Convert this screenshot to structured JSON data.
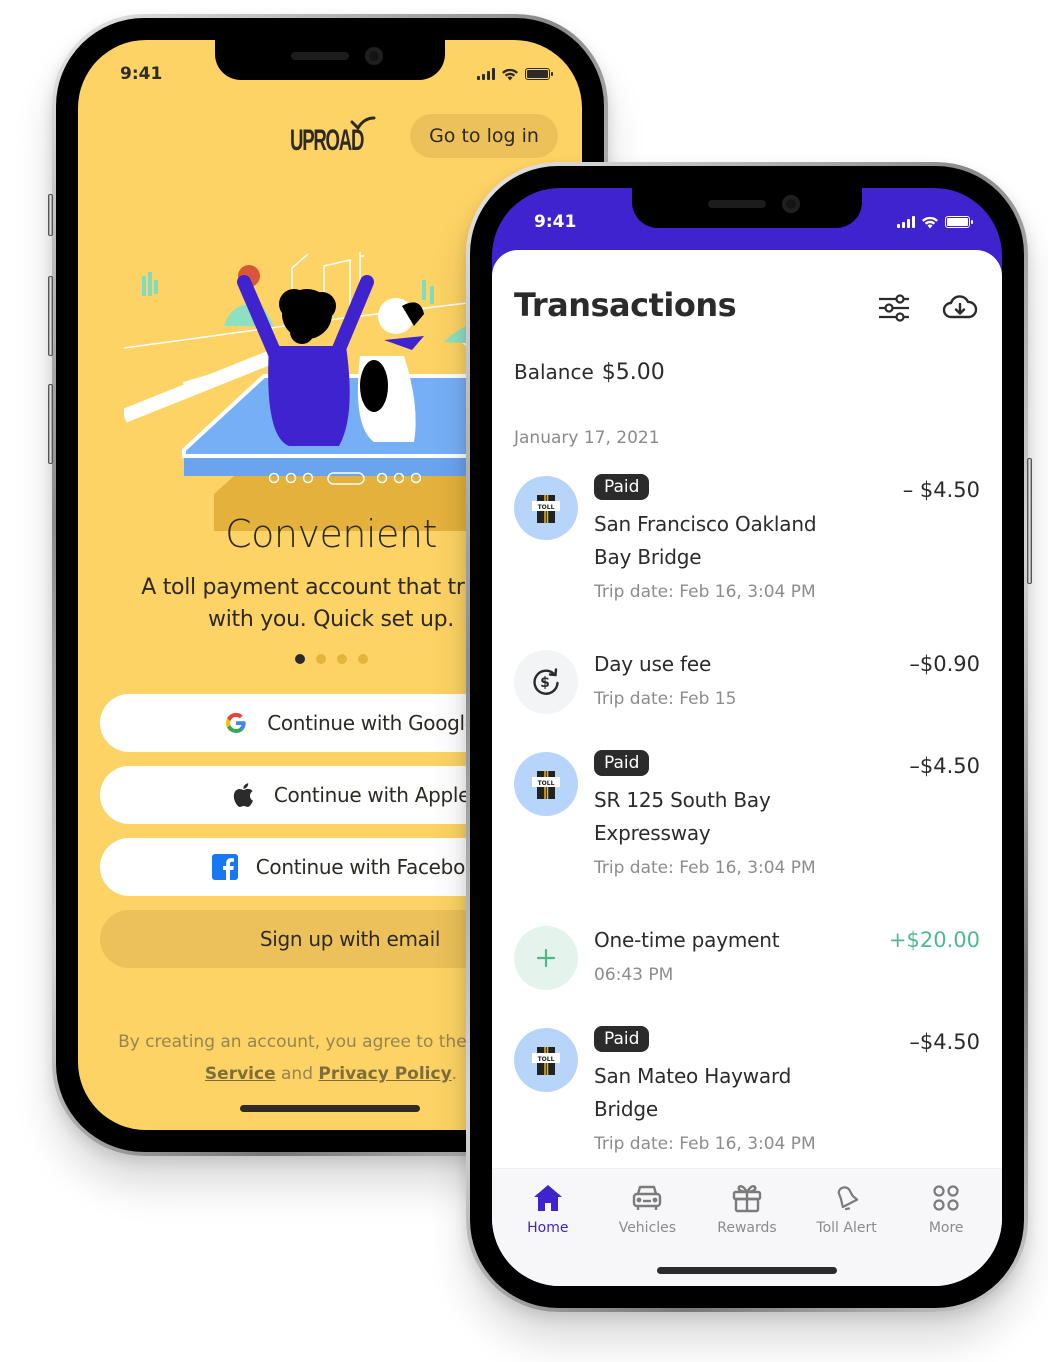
{
  "left_phone": {
    "status_time": "9:41",
    "brand": "UPROAD",
    "login_button": "Go to log in",
    "slide": {
      "title": "Convenient",
      "description": "A toll payment account that travels\nwith you. Quick set up.",
      "page_count": 4,
      "active_page": 1
    },
    "auth_buttons": [
      {
        "label": "Continue with Google",
        "icon": "google-icon"
      },
      {
        "label": "Continue with Apple",
        "icon": "apple-icon"
      },
      {
        "label": "Continue with Facebook",
        "icon": "facebook-icon"
      },
      {
        "label": "Sign up with email",
        "icon": null
      }
    ],
    "legal": {
      "prefix": "By creating an account, you agree to the Terms of",
      "terms_link": "Service",
      "and": " and ",
      "privacy_link": "Privacy Policy",
      "suffix": "."
    },
    "colors": {
      "background": "#fdd365",
      "pill": "#ecc15a"
    }
  },
  "right_phone": {
    "status_time": "9:41",
    "title": "Transactions",
    "icons": [
      "filter-sliders-icon",
      "cloud-download-icon"
    ],
    "balance_label": "Balance",
    "balance_value": "$5.00",
    "date_header": "January 17, 2021",
    "transactions": [
      {
        "type": "toll",
        "badge": "Paid",
        "name": "San Francisco Oakland\nBay Bridge",
        "sub": "Trip date: Feb 16, 3:04 PM",
        "amount": "– $4.50"
      },
      {
        "type": "fee",
        "badge": null,
        "name": "Day use fee",
        "sub": "Trip date: Feb 15",
        "amount": "–$0.90"
      },
      {
        "type": "toll",
        "badge": "Paid",
        "name": "SR 125 South Bay\nExpressway",
        "sub": "Trip date: Feb 16, 3:04 PM",
        "amount": "–$4.50"
      },
      {
        "type": "payment",
        "badge": null,
        "name": "One-time payment",
        "sub": "06:43 PM",
        "amount": "+$20.00"
      },
      {
        "type": "toll",
        "badge": "Paid",
        "name": "San Mateo Hayward\nBridge",
        "sub": "Trip date: Feb 16, 3:04 PM",
        "amount": "–$4.50"
      }
    ],
    "toll_icon_label": "TOLL",
    "tabs": [
      {
        "label": "Home",
        "icon": "home-icon",
        "active": true
      },
      {
        "label": "Vehicles",
        "icon": "car-icon",
        "active": false
      },
      {
        "label": "Rewards",
        "icon": "gift-icon",
        "active": false
      },
      {
        "label": "Toll Alert",
        "icon": "bell-icon",
        "active": false
      },
      {
        "label": "More",
        "icon": "more-grid-icon",
        "active": false
      }
    ],
    "colors": {
      "accent": "#3e23cf",
      "credit": "#4fb98a",
      "badge": "#2b2b2b"
    }
  }
}
